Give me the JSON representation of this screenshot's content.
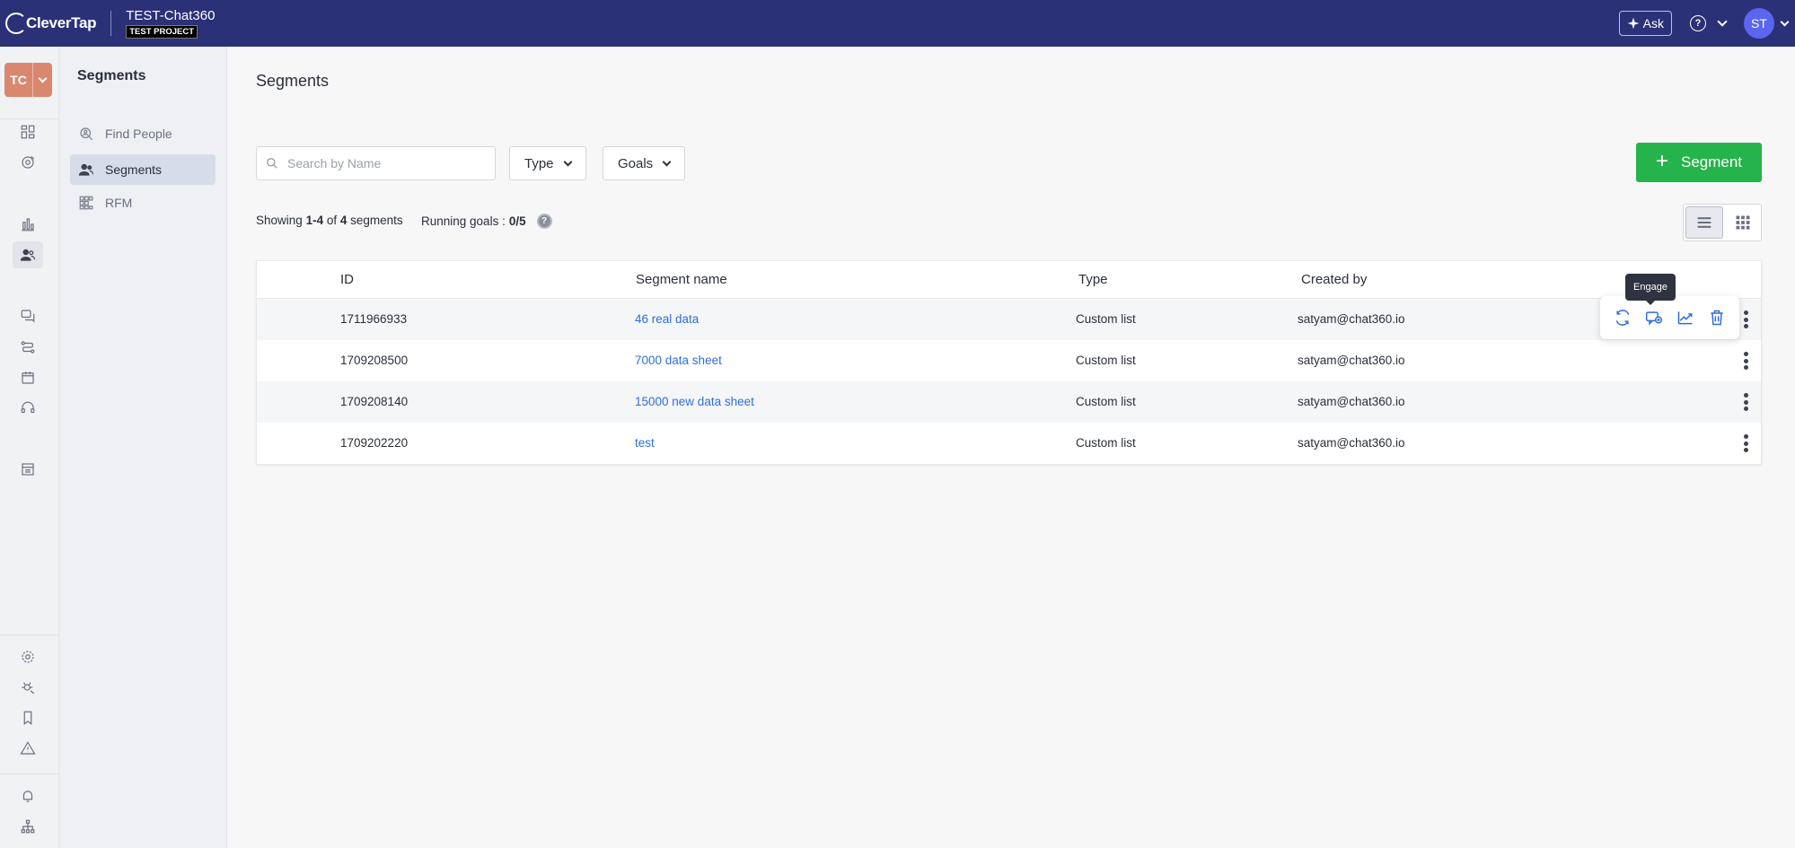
{
  "header": {
    "logo_text": "CleverTap",
    "project_name": "TEST-Chat360",
    "project_badge": "TEST PROJECT",
    "ask_label": "Ask",
    "help_symbol": "?",
    "avatar_initials": "ST",
    "colors": {
      "bar": "#2b3177",
      "avatar": "#5a65f0"
    }
  },
  "rail": {
    "project_initials": "TC",
    "project_color": "#d9876f",
    "icons": [
      "dashboard-icon",
      "campaign-icon",
      "analytics-icon",
      "people-icon",
      "messages-icon",
      "journeys-icon",
      "content-icon",
      "support-icon",
      "catalog-icon",
      "settings-icon",
      "debug-icon",
      "bookmark-icon",
      "alert-icon",
      "notification-icon",
      "hierarchy-icon"
    ]
  },
  "subnav": {
    "title": "Segments",
    "items": [
      {
        "label": "Find People",
        "icon": "find-people-icon"
      },
      {
        "label": "Segments",
        "icon": "segments-icon",
        "active": true
      },
      {
        "label": "RFM",
        "icon": "rfm-icon"
      }
    ]
  },
  "main": {
    "title": "Segments",
    "search_placeholder": "Search by Name",
    "filters": {
      "type_label": "Type",
      "goals_label": "Goals"
    },
    "add_button_label": "Segment",
    "showing": {
      "prefix": "Showing",
      "range": "1-4",
      "of": "of",
      "total": "4",
      "suffix": "segments"
    },
    "running_goals": {
      "label": "Running goals :",
      "value": "0/5"
    },
    "view_mode": "list",
    "accent_color": "#25b34b"
  },
  "table": {
    "columns": [
      "ID",
      "Segment name",
      "Type",
      "Created by"
    ],
    "rows": [
      {
        "id": "1711966933",
        "name": "46 real data",
        "type": "Custom list",
        "created_by": "satyam@chat360.io"
      },
      {
        "id": "1709208500",
        "name": "7000 data sheet",
        "type": "Custom list",
        "created_by": "satyam@chat360.io"
      },
      {
        "id": "1709208140",
        "name": "15000 new data sheet",
        "type": "Custom list",
        "created_by": "satyam@chat360.io"
      },
      {
        "id": "1709202220",
        "name": "test",
        "type": "Custom list",
        "created_by": "satyam@chat360.io"
      }
    ],
    "link_color": "#2e6fd6"
  },
  "row_actions": {
    "tooltip": "Engage",
    "icons": [
      "refresh-icon",
      "engage-icon",
      "trend-icon",
      "delete-icon"
    ]
  }
}
